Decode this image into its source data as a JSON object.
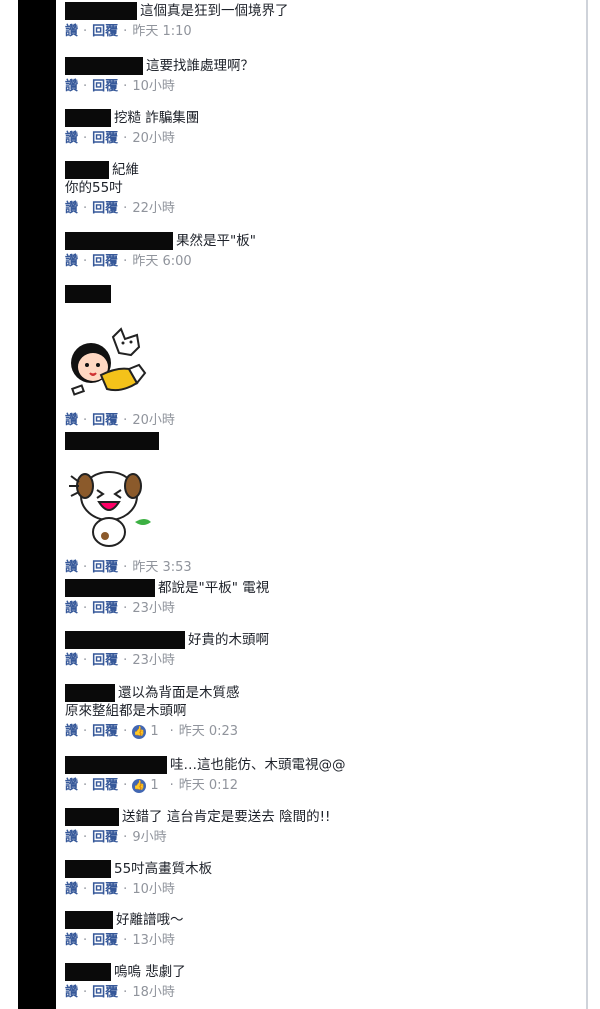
{
  "actions": {
    "like": "讚",
    "reply": "回覆",
    "separator": "·"
  },
  "comments": [
    {
      "text": "這個真是狂到一個境界了",
      "time": "昨天 1:10"
    },
    {
      "text": "這要找誰處理啊？",
      "time": "10小時"
    },
    {
      "text": "挖糙 詐騙集團",
      "time": "20小時"
    },
    {
      "text": "紀維",
      "text2": "你的55吋",
      "time": "22小時"
    },
    {
      "text": "果然是平\"板\"",
      "time": "昨天 6:00"
    },
    {
      "sticker": "girl-with-cat-sticker",
      "time": "20小時"
    },
    {
      "sticker": "laughing-dog-sticker",
      "time": "昨天 3:53"
    },
    {
      "text": "都說是\"平板\" 電視",
      "time": "23小時"
    },
    {
      "text": "好貴的木頭啊",
      "time": "23小時"
    },
    {
      "text": "還以為背面是木質感",
      "text2": "原來整組都是木頭啊",
      "likes": "1",
      "time": "昨天 0:23"
    },
    {
      "text": "哇…這也能仿、木頭電視@@",
      "likes": "1",
      "time": "昨天 0:12"
    },
    {
      "text": "送錯了 這台肯定是要送去 陰間的!!",
      "time": "9小時"
    },
    {
      "text": "55吋高畫質木板",
      "time": "10小時"
    },
    {
      "text": "好離譜哦～",
      "time": "13小時"
    },
    {
      "text": "嗚嗚 悲劇了",
      "time": "18小時"
    }
  ]
}
